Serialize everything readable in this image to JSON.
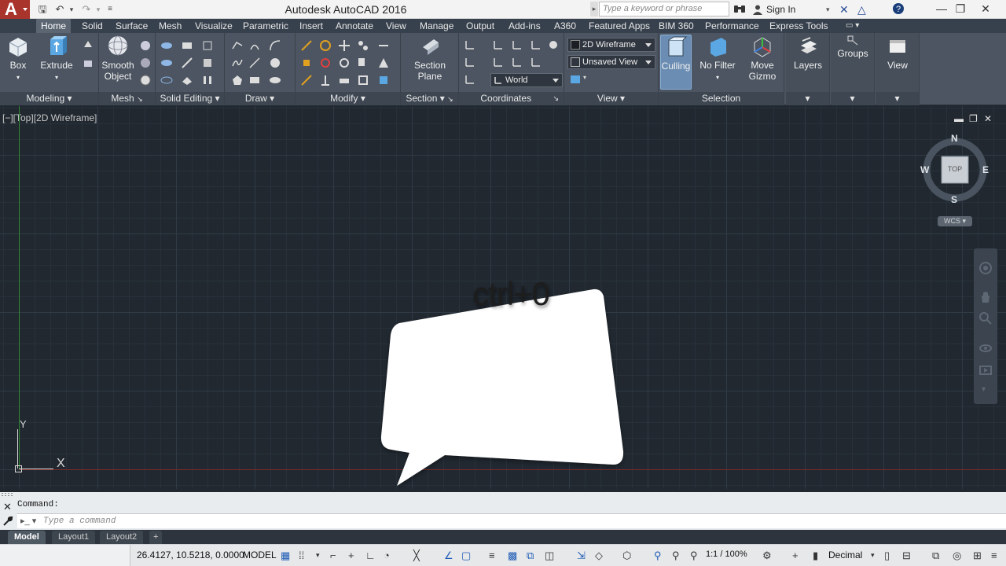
{
  "window": {
    "title": "Autodesk AutoCAD 2016",
    "search_placeholder": "Type a keyword or phrase",
    "sign_in": "Sign In"
  },
  "tabs": [
    "Home",
    "Solid",
    "Surface",
    "Mesh",
    "Visualize",
    "Parametric",
    "Insert",
    "Annotate",
    "View",
    "Manage",
    "Output",
    "Add-ins",
    "A360",
    "Featured Apps",
    "BIM 360",
    "Performance",
    "Express Tools"
  ],
  "ribbon": {
    "buttons": {
      "box": "Box",
      "extrude": "Extrude",
      "smooth_object_1": "Smooth",
      "smooth_object_2": "Object",
      "section_plane_1": "Section",
      "section_plane_2": "Plane",
      "culling": "Culling",
      "no_filter": "No Filter",
      "move_gizmo_1": "Move",
      "move_gizmo_2": "Gizmo",
      "layers": "Layers",
      "groups": "Groups",
      "view": "View"
    },
    "panels": {
      "modeling": "Modeling",
      "mesh": "Mesh",
      "solid_editing": "Solid Editing",
      "draw": "Draw",
      "modify": "Modify",
      "section": "Section",
      "coordinates": "Coordinates",
      "view": "View",
      "selection": "Selection"
    },
    "selects": {
      "visual_style": "2D Wireframe",
      "named_view": "Unsaved View",
      "ucs": "World"
    }
  },
  "viewport": {
    "label": "[−][Top][2D Wireframe]",
    "viewcube": {
      "n": "N",
      "s": "S",
      "e": "E",
      "w": "W",
      "face": "TOP",
      "wcs": "WCS"
    },
    "ucs_x": "X",
    "ucs_y": "Y"
  },
  "bubble": {
    "text": "ctrl+0"
  },
  "command": {
    "history": "Command:",
    "placeholder": "Type a command"
  },
  "layout_tabs": [
    "Model",
    "Layout1",
    "Layout2"
  ],
  "status": {
    "coords": "26.4127, 10.5218, 0.0000",
    "model": "MODEL",
    "scale": "1:1 / 100%",
    "units": "Decimal"
  },
  "colors": {
    "canvas": "#212830",
    "ribbon": "#4c5561",
    "accent": "#1e5bb5",
    "logo": "#a8342c"
  }
}
